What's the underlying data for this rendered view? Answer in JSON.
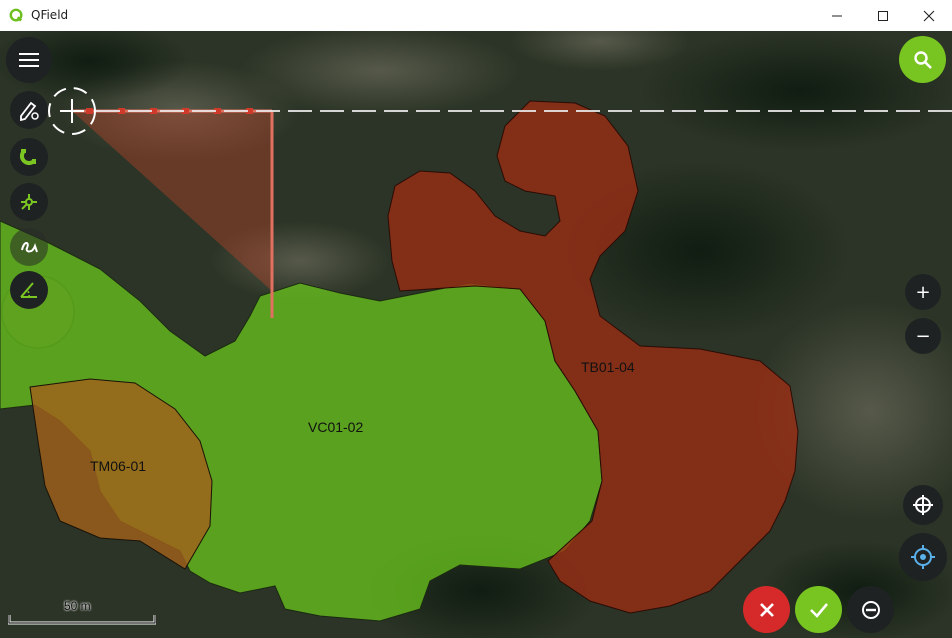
{
  "window": {
    "title": "QField",
    "controls": {
      "minimize": "minimize-icon",
      "maximize": "maximize-icon",
      "close": "close-icon"
    }
  },
  "map": {
    "features": [
      {
        "label": "TB01-04",
        "class": "brown-red",
        "color": "#9a2d14"
      },
      {
        "label": "VC01-02",
        "class": "green",
        "color": "#66c01c"
      },
      {
        "label": "TM06-01",
        "class": "orange-brown",
        "color": "#a0601c"
      }
    ],
    "scale": {
      "label": "50 m"
    }
  },
  "toolbar": {
    "menu": "menu-icon",
    "digitize": "pencil-settings-icon",
    "snapping": "magnet-icon",
    "topology": "vertex-node-icon",
    "freehand": "freehand-icon",
    "angle": "angle-icon"
  },
  "controls": {
    "search": "search-icon",
    "zoom_in": "+",
    "zoom_out": "−",
    "crosshair": "crosshair-icon",
    "gps": "gps-icon",
    "cancel": "cancel-icon",
    "confirm": "check-icon",
    "remove_vertex": "remove-vertex-icon"
  },
  "colors": {
    "accent_green": "#78c420",
    "cancel_red": "#d62a2a",
    "dark_button": "#1e2223"
  }
}
